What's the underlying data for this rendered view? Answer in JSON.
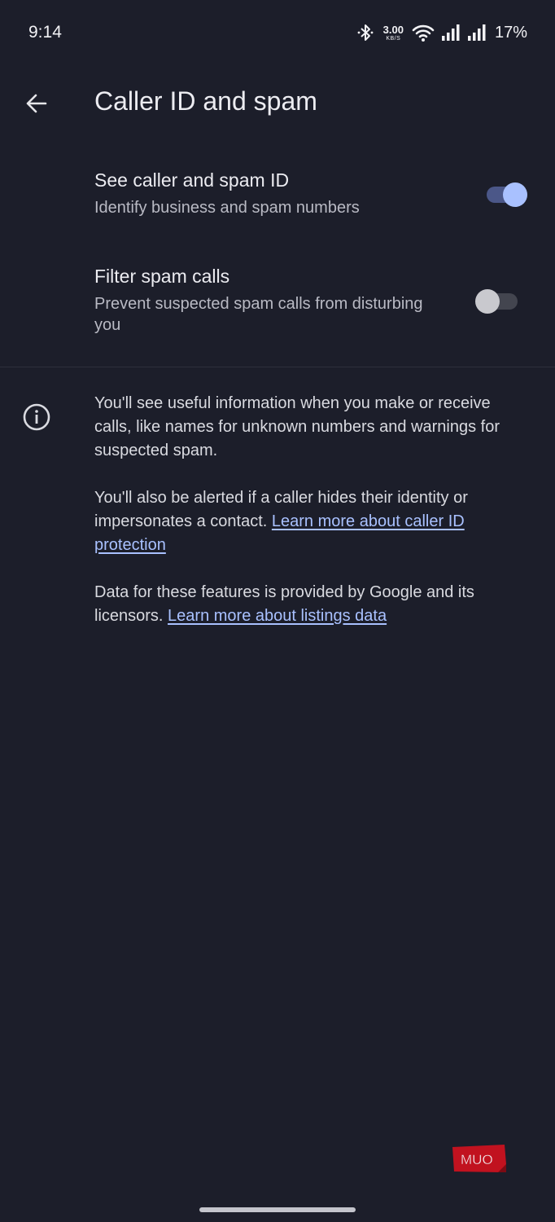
{
  "status_bar": {
    "time": "9:14",
    "net_speed_value": "3.00",
    "net_speed_unit": "KB/S",
    "battery_percent": "17%",
    "icons": [
      "bluetooth-icon",
      "wifi-icon",
      "signal-icon",
      "signal-icon",
      "battery-percent"
    ]
  },
  "header": {
    "title": "Caller ID and spam",
    "back_icon": "arrow-back-icon"
  },
  "settings": [
    {
      "title": "See caller and spam ID",
      "summary": "Identify business and spam numbers",
      "enabled": true
    },
    {
      "title": "Filter spam calls",
      "summary": "Prevent suspected spam calls from disturbing you",
      "enabled": false
    }
  ],
  "info": {
    "icon": "info-icon",
    "paragraph1": "You'll see useful information when you make or receive calls, like names for unknown numbers and warnings for suspected spam.",
    "paragraph2_text": "You'll also be alerted if a caller hides their identity or impersonates a contact.",
    "paragraph2_link": "Learn more about caller ID protection",
    "paragraph3_text": "Data for these features is provided by Google and its licensors.",
    "paragraph3_link": "Learn more about listings data"
  },
  "watermark": {
    "text": "MUO"
  },
  "colors": {
    "background": "#1c1e2a",
    "accent": "#a9c1ff",
    "switch_on_track": "#4b5788",
    "switch_off_track": "#43454f",
    "watermark": "#c1121f"
  }
}
